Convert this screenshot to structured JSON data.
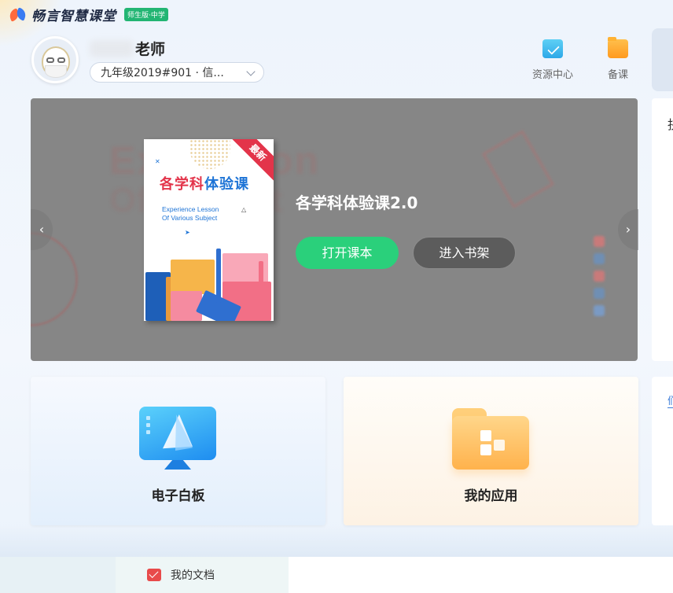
{
  "app": {
    "logo_text": "畅言智慧课堂",
    "edition_badge": "师生版·中学"
  },
  "profile": {
    "name_suffix": "老师",
    "class_select_value": "九年级2019#901 · 信..."
  },
  "header_nav": {
    "resource_center": "资源中心",
    "lesson_prep": "备课"
  },
  "banner": {
    "book_ribbon": "最新",
    "book_title_part1": "各学科",
    "book_title_part2": "体验课",
    "book_en_line1": "Experience Lesson",
    "book_en_line2": "Of Various Subject",
    "title": "各学科体验课2.0",
    "open_button": "打开课本",
    "shelf_button": "进入书架",
    "prev_arrow": "‹",
    "next_arrow": "›"
  },
  "cards": {
    "whiteboard": "电子白板",
    "my_apps": "我的应用"
  },
  "right_panel": {
    "top_char": "抉",
    "bottom_char": "们"
  },
  "footer": {
    "my_docs": "我的文档"
  },
  "colors": {
    "green_button": "#2ad07b",
    "brand_blue": "#1e74d6",
    "brand_red": "#e3344a"
  }
}
